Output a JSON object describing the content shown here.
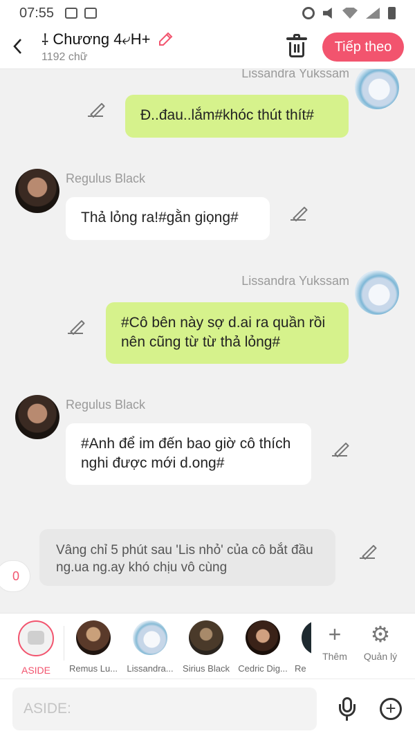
{
  "status_bar": {
    "time": "07:55"
  },
  "header": {
    "back_icon": "chevron-left-icon",
    "title_prefix_glyph": "⸸",
    "title": "Chương 4⤶H+",
    "word_count": "1192 chữ",
    "next_label": "Tiếp theo"
  },
  "messages": [
    {
      "speaker": "Lissandra Yukssam",
      "side": "right",
      "text": "Đ..đau..lắm#khóc thút thít#"
    },
    {
      "speaker": "Regulus Black",
      "side": "left",
      "text": "Thả lỏng ra!#gằn giọng#"
    },
    {
      "speaker": "Lissandra Yukssam",
      "side": "right",
      "text": "#Cô bên này sợ d.ai ra quần rồi nên cũng từ từ thả lỏng#"
    },
    {
      "speaker": "Regulus Black",
      "side": "left",
      "text": "#Anh để im đến bao giờ cô thích nghi được mới d.ong#"
    },
    {
      "speaker": "",
      "side": "aside",
      "text": "Vâng chỉ 5 phút sau 'Lis nhỏ' của cô bắt đầu ng.ua ng.ay khó chịu vô cùng"
    }
  ],
  "comment_count": "0",
  "characters": [
    {
      "label": "ASIDE",
      "selected": true
    },
    {
      "label": "Remus Lu..."
    },
    {
      "label": "Lissandra..."
    },
    {
      "label": "Sirius Black"
    },
    {
      "label": "Cedric Dig..."
    },
    {
      "label": "Re"
    }
  ],
  "tools": {
    "add_label": "Thêm",
    "manage_label": "Quản lý"
  },
  "input": {
    "placeholder": "ASIDE:"
  },
  "colors": {
    "accent": "#f2546e",
    "self_bubble": "#d6f28c",
    "other_bubble": "#ffffff",
    "aside_bubble": "#e8e8e8"
  }
}
